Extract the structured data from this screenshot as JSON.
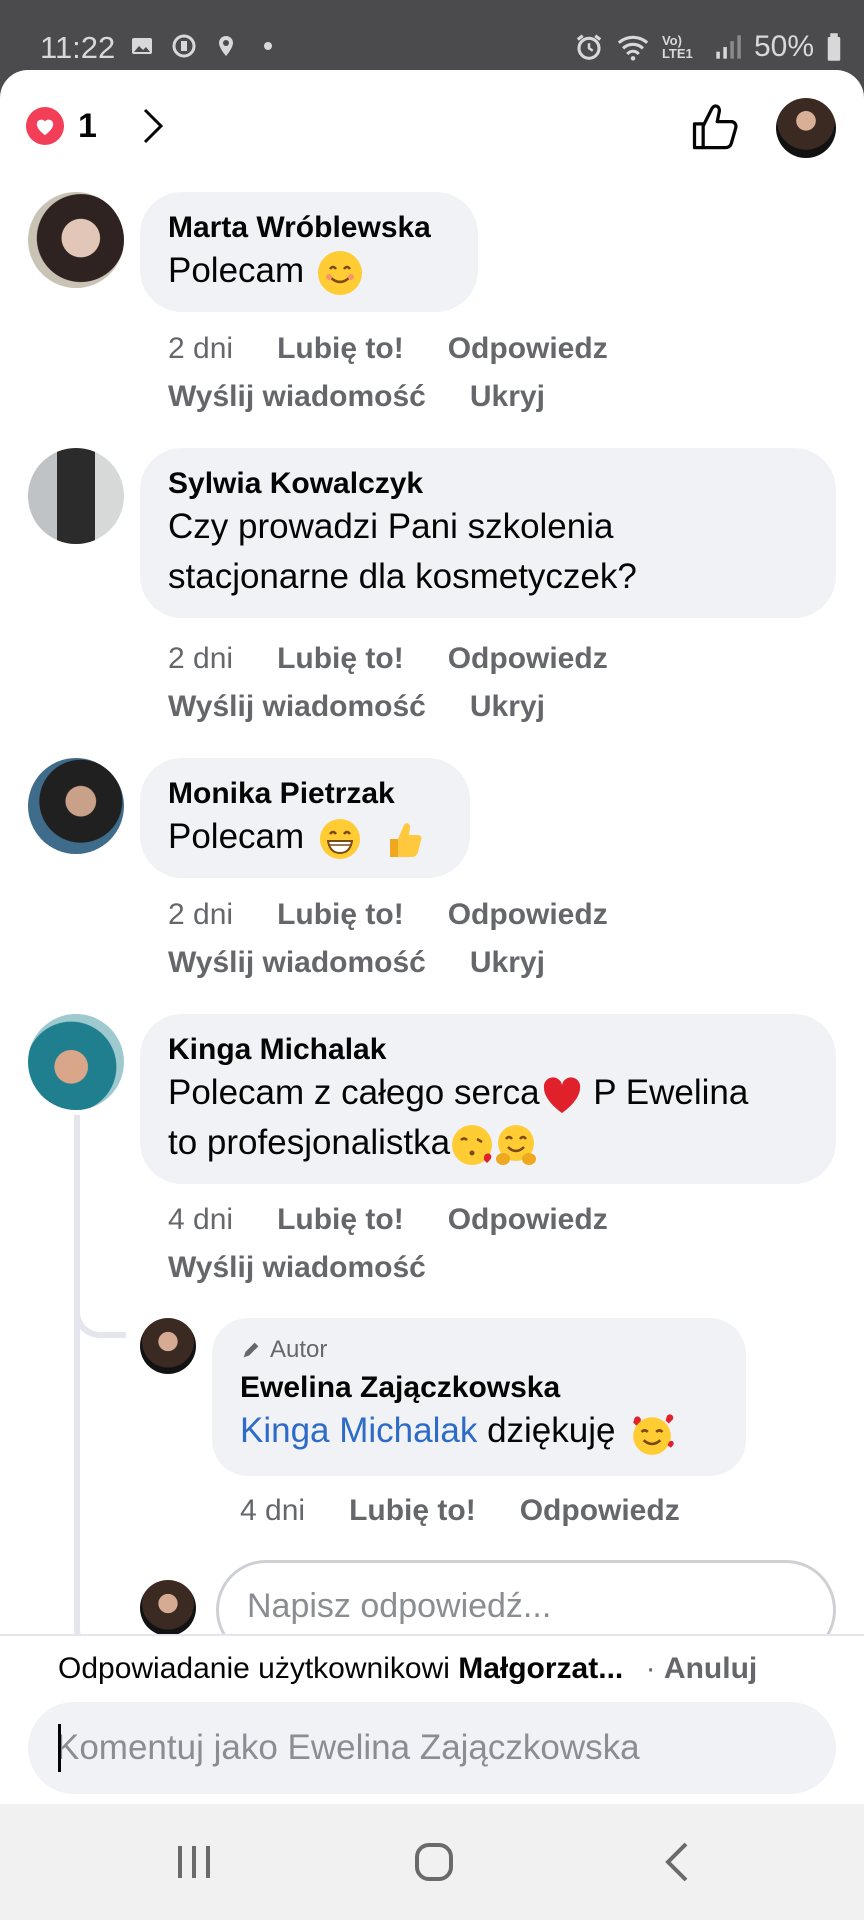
{
  "status_bar": {
    "time": "11:22",
    "battery": "50%",
    "icons": [
      "image-icon",
      "messenger-icon",
      "location-icon",
      "dot-icon",
      "alarm-icon",
      "wifi-icon",
      "volte-icon",
      "signal-icon",
      "battery-icon"
    ],
    "volte_label": "Vo) LTE1"
  },
  "header": {
    "reaction_count": "1",
    "reaction_icon": "heart-icon"
  },
  "comments": [
    {
      "author": "Marta Wróblewska",
      "text": "Polecam",
      "emojis": [
        "smiling-face"
      ],
      "time": "2 dni",
      "like": "Lubię to!",
      "reply": "Odpowiedz",
      "message": "Wyślij wiadomość",
      "hide": "Ukryj"
    },
    {
      "author": "Sylwia Kowalczyk",
      "text_line1": "Czy prowadzi Pani szkolenia",
      "text_line2": "stacjonarne dla kosmetyczek?",
      "time": "2 dni",
      "like": "Lubię to!",
      "reply": "Odpowiedz",
      "message": "Wyślij wiadomość",
      "hide": "Ukryj"
    },
    {
      "author": "Monika Pietrzak",
      "text": "Polecam",
      "emojis": [
        "grinning-face",
        "thumbs-up"
      ],
      "time": "2 dni",
      "like": "Lubię to!",
      "reply": "Odpowiedz",
      "message": "Wyślij wiadomość",
      "hide": "Ukryj"
    },
    {
      "author": "Kinga Michalak",
      "text_line1_a": "Polecam z całego serca",
      "text_line1_b": " P Ewelina",
      "text_line2": "to profesjonalistka",
      "emojis": [
        "red-heart",
        "face-blowing-kiss",
        "hugging-face"
      ],
      "time": "4 dni",
      "like": "Lubię to!",
      "reply": "Odpowiedz",
      "message": "Wyślij wiadomość"
    }
  ],
  "reply": {
    "badge": "Autor",
    "author": "Ewelina Zajączkowska",
    "mention": "Kinga Michalak",
    "text": " dziękuję",
    "emojis": [
      "smiling-face-with-hearts"
    ],
    "time": "4 dni",
    "like": "Lubię to!",
    "reply": "Odpowiedz"
  },
  "reply_input": {
    "placeholder": "Napisz odpowiedź..."
  },
  "compose": {
    "replying_prefix": "Odpowiadanie użytkownikowi ",
    "replying_name": "Małgorzat...",
    "separator": "·",
    "cancel": "Anuluj",
    "placeholder": "Komentuj jako Ewelina Zajączkowska"
  },
  "navbar": {
    "buttons": [
      "recents-icon",
      "home-icon",
      "back-icon"
    ]
  }
}
